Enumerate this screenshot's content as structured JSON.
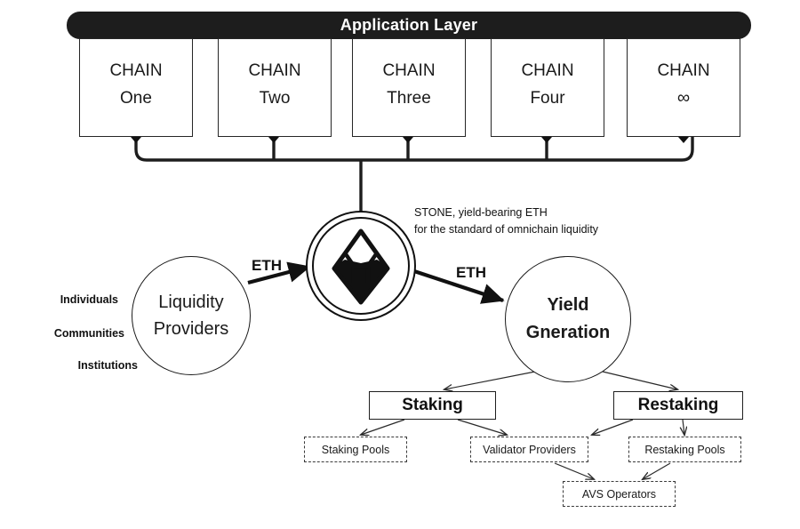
{
  "header": {
    "title": "Application Layer"
  },
  "chains": [
    {
      "prefix": "CHAIN",
      "name": "One"
    },
    {
      "prefix": "CHAIN",
      "name": "Two"
    },
    {
      "prefix": "CHAIN",
      "name": "Three"
    },
    {
      "prefix": "CHAIN",
      "name": "Four"
    },
    {
      "prefix": "CHAIN",
      "name": "∞"
    }
  ],
  "logo": {
    "icon": "stone-gem-icon",
    "note_line1": "STONE, yield-bearing ETH",
    "note_line2": "for the standard of omnichain liquidity"
  },
  "liquidity": {
    "line1": "Liquidity",
    "line2": "Providers",
    "side_labels": [
      "Individuals",
      "Communities",
      "Institutions"
    ]
  },
  "yield": {
    "line1": "Yield",
    "line2": "Gneration"
  },
  "flows": {
    "eth_left": "ETH",
    "eth_right": "ETH"
  },
  "yield_branches": {
    "staking": "Staking",
    "restaking": "Restaking"
  },
  "leaf_nodes": {
    "staking_pools": "Staking Pools",
    "validator_providers": "Validator Providers",
    "restaking_pools": "Restaking Pools",
    "avs_operators": "AVS Operators"
  },
  "colors": {
    "header_bg": "#1d1d1d",
    "header_text": "#ffffff",
    "stroke": "#1a1a1a",
    "dashed_stroke": "#3a3a3a",
    "canvas": "#ffffff"
  }
}
